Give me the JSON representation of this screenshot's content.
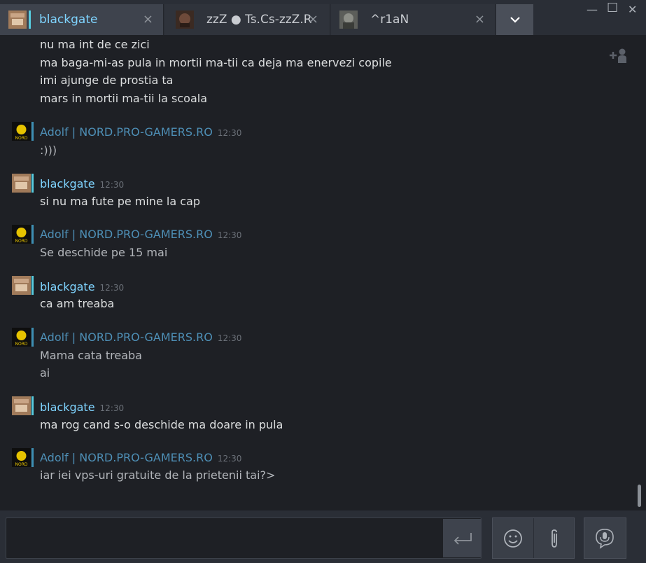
{
  "tabs": [
    {
      "label": "blackgate",
      "active": true
    },
    {
      "label": "zzZ ● Ts.Cs-zzZ.Ro",
      "active": false
    },
    {
      "label": "^r1aN",
      "active": false
    }
  ],
  "tab_close_glyph": "×",
  "overflow_icon": "chevron-down-icon",
  "window": {
    "minimize": "—",
    "maximize": "☐",
    "close": "✕"
  },
  "messages": [
    {
      "sender": "",
      "time": "",
      "lines": [
        "nu ma int de ce zici",
        "ma baga-mi-as pula in mortii ma-tii ca deja ma enervezi copile",
        "imi ajunge de prostia ta",
        "mars in mortii ma-tii la scoala"
      ]
    },
    {
      "sender": "Adolf | NORD.PRO-GAMERS.RO",
      "time": "12:30",
      "lines": [
        ":)))"
      ]
    },
    {
      "sender": "blackgate",
      "time": "12:30",
      "lines": [
        "si nu ma fute pe mine la cap"
      ]
    },
    {
      "sender": "Adolf | NORD.PRO-GAMERS.RO",
      "time": "12:30",
      "lines": [
        "Se deschide pe 15 mai"
      ]
    },
    {
      "sender": "blackgate",
      "time": "12:30",
      "lines": [
        "ca am treaba"
      ]
    },
    {
      "sender": "Adolf | NORD.PRO-GAMERS.RO",
      "time": "12:30",
      "lines": [
        "Mama cata treaba",
        "ai"
      ]
    },
    {
      "sender": "blackgate",
      "time": "12:30",
      "lines": [
        "ma rog cand s-o deschide ma doare in pula"
      ]
    },
    {
      "sender": "Adolf | NORD.PRO-GAMERS.RO",
      "time": "12:30",
      "lines": [
        "iar iei vps-uri gratuite de la prietenii tai?>"
      ]
    }
  ],
  "nord_avatar_text": "NORD",
  "input": {
    "placeholder": "",
    "value": ""
  },
  "colors": {
    "self_name": "#7fd4ff",
    "other_name": "#4e8fb6",
    "accent_bar": "#57cbde"
  }
}
